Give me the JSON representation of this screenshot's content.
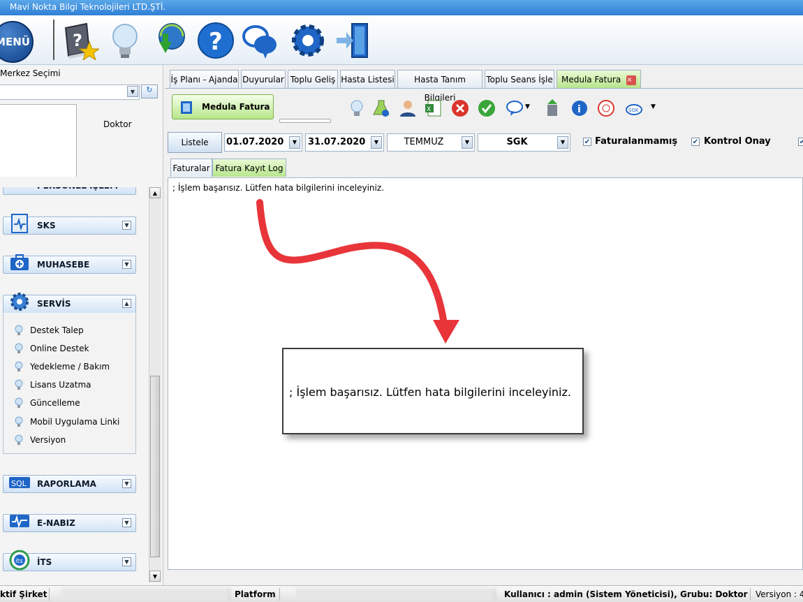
{
  "window": {
    "title": "Mavi Nokta Bilgi Teknolojileri LTD.ŞTİ."
  },
  "toolbar": {
    "menu_label": "MENÜ",
    "icons": [
      "book-star-icon",
      "lightbulb-icon",
      "refresh-globe-icon",
      "help-icon",
      "chat-bubbles-icon",
      "gear-icon",
      "exit-door-icon"
    ]
  },
  "sidebar": {
    "center_label": "Merkez Seçimi",
    "center_value": "",
    "doctor_label": "Doktor",
    "groups": [
      {
        "name": "PERSONEL İŞLEM"
      },
      {
        "name": "SKS"
      },
      {
        "name": "MUHASEBE"
      },
      {
        "name": "SERVİS"
      },
      {
        "name": "RAPORLAMA"
      },
      {
        "name": "E-NABIZ"
      },
      {
        "name": "İTS"
      }
    ],
    "servis_items": [
      "Destek Talep",
      "Online Destek",
      "Yedekleme / Bakım",
      "Lisans Uzatma",
      "Güncelleme",
      "Mobil Uygulama Linki",
      "Versiyon"
    ]
  },
  "tabs": [
    "İş Planı - Ajanda",
    "Duyurular",
    "Toplu Geliş",
    "Hasta Listesi",
    "Hasta Tanım Bilgileri",
    "Toplu Seans İşle",
    "Medula Fatura"
  ],
  "medula": {
    "title": "Medula Fatura",
    "list_button": "Listele",
    "date_from": "01.07.2020",
    "date_to": "31.07.2020",
    "month": "TEMMUZ",
    "institution": "SGK",
    "check_unbilled": "Faturalanmamış",
    "check_control": "Kontrol Onay",
    "subtabs": [
      "Faturalar",
      "Fatura Kayıt Log"
    ],
    "log_line": "; İşlem başarısız. Lütfen hata bilgilerini inceleyiniz.",
    "popup_text": "; İşlem başarısız. Lütfen hata bilgilerini inceleyiniz."
  },
  "statusbar": {
    "active_company_label": "ktif Şirket",
    "platform_label": "Platform",
    "user": "Kullanıcı : admin (Sistem Yöneticisi), Grubu: Doktor",
    "version": "Versiyon : 4"
  },
  "colors": {
    "arrow": "#e8353a",
    "active_tab": "#b7e58d",
    "title_bar": "#2f7fd6"
  }
}
